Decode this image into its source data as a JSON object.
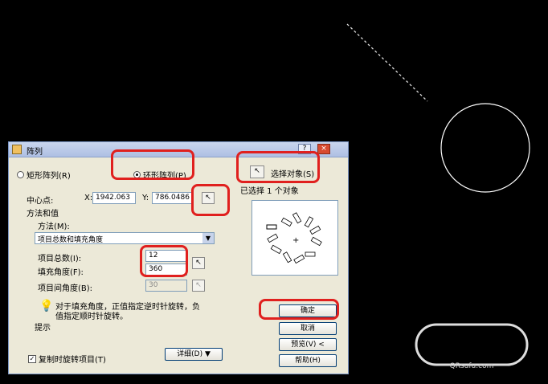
{
  "dialog": {
    "title": "阵列",
    "help_glyph": "?",
    "close_glyph": "×",
    "rect_array": "矩形阵列(R)",
    "polar_array": "环形阵列(P)",
    "select_objects": "选择对象(S)",
    "selected_count": "已选择 1 个对象",
    "center_label": "中心点:",
    "x_label": "X:",
    "x_value": "1942.063",
    "y_label": "Y:",
    "y_value": "786.0486",
    "method_group": "方法和值",
    "method_label": "方法(M):",
    "method_value": "项目总数和填充角度",
    "total_items_label": "项目总数(I):",
    "total_items_value": "12",
    "fill_angle_label": "填充角度(F):",
    "fill_angle_value": "360",
    "item_angle_label": "项目间角度(B):",
    "item_angle_value": "30",
    "hint_text_1": "对于填充角度，正值指定逆时针旋转，负",
    "hint_text_2": "值指定顺时针旋转。",
    "hint_title": "提示",
    "rotate_items": "复制时旋转项目(T)",
    "details_button": "详细(D) ▼",
    "ok_button": "确定",
    "cancel_button": "取消",
    "preview_button": "预览(V) <",
    "help_button": "帮助(H)"
  },
  "watermark": {
    "text": "QRsufu.com"
  },
  "colors": {
    "annotation_red": "#e0201e",
    "canvas_bg": "#000000",
    "entity_white": "#ffffff"
  }
}
